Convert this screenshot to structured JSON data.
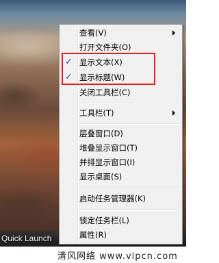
{
  "menu": {
    "items": [
      {
        "label": "查看(V)",
        "submenu": true
      },
      {
        "label": "打开文件夹(O)"
      },
      {
        "label": "显示文本(X)",
        "checked": true
      },
      {
        "label": "显示标题(W)",
        "checked": true
      },
      {
        "label": "关闭工具栏(C)"
      },
      {
        "label": "工具栏(T)",
        "submenu": true
      },
      {
        "label": "层叠窗口(D)"
      },
      {
        "label": "堆叠显示窗口(T)"
      },
      {
        "label": "并排显示窗口(I)"
      },
      {
        "label": "显示桌面(S)"
      },
      {
        "label": "启动任务管理器(K)"
      },
      {
        "label": "锁定任务栏(L)"
      },
      {
        "label": "属性(R)"
      }
    ],
    "check_mark": "✓"
  },
  "taskbar": {
    "quick_launch_label": "Quick Launch"
  },
  "watermark": {
    "text": "清风网络 www.vipcn.com"
  },
  "colors": {
    "highlight_border": "#e02020",
    "check": "#1a4fb0",
    "menu_bg": "#f0f0f0"
  }
}
